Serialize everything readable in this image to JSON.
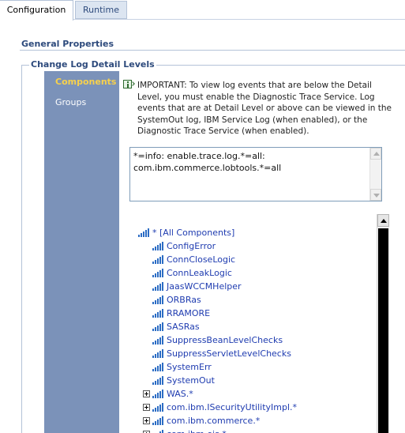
{
  "tabs": {
    "configuration": "Configuration",
    "runtime": "Runtime"
  },
  "section": {
    "title": "General Properties"
  },
  "fieldset": {
    "legend": "Change Log Detail Levels"
  },
  "sidebar": {
    "items": [
      {
        "label": "Components",
        "selected": true
      },
      {
        "label": "Groups",
        "selected": false
      }
    ]
  },
  "info": {
    "lines": [
      "IMPORTANT: To view log events that are below the Detail",
      "Level, you must enable the Diagnostic Trace Service. Log",
      "events that are at Detail Level or above can be viewed in the",
      "SystemOut log, IBM Service Log (when enabled), or the",
      "Diagnostic Trace Service (when enabled)."
    ]
  },
  "trace": {
    "value": "*=info: enable.trace.log.*=all:\ncom.ibm.commerce.lobtools.*=all"
  },
  "tree": {
    "root": "* [All Components]",
    "items": [
      {
        "label": "ConfigError",
        "expandable": false
      },
      {
        "label": "ConnCloseLogic",
        "expandable": false
      },
      {
        "label": "ConnLeakLogic",
        "expandable": false
      },
      {
        "label": "JaasWCCMHelper",
        "expandable": false
      },
      {
        "label": "ORBRas",
        "expandable": false
      },
      {
        "label": "RRAMORE",
        "expandable": false
      },
      {
        "label": "SASRas",
        "expandable": false
      },
      {
        "label": "SuppressBeanLevelChecks",
        "expandable": false
      },
      {
        "label": "SuppressServletLevelChecks",
        "expandable": false
      },
      {
        "label": "SystemErr",
        "expandable": false
      },
      {
        "label": "SystemOut",
        "expandable": false
      },
      {
        "label": "WAS.*",
        "expandable": true
      },
      {
        "label": "com.ibm.ISecurityUtilityImpl.*",
        "expandable": true
      },
      {
        "label": "com.ibm.commerce.*",
        "expandable": true
      },
      {
        "label": "com.ibm.ejs.*",
        "expandable": true
      }
    ]
  },
  "colors": {
    "sidebar_bg": "#7b92b9",
    "selected_text": "#f7d14c",
    "header_text": "#2d4a7c",
    "link_text": "#1f3cb0"
  }
}
